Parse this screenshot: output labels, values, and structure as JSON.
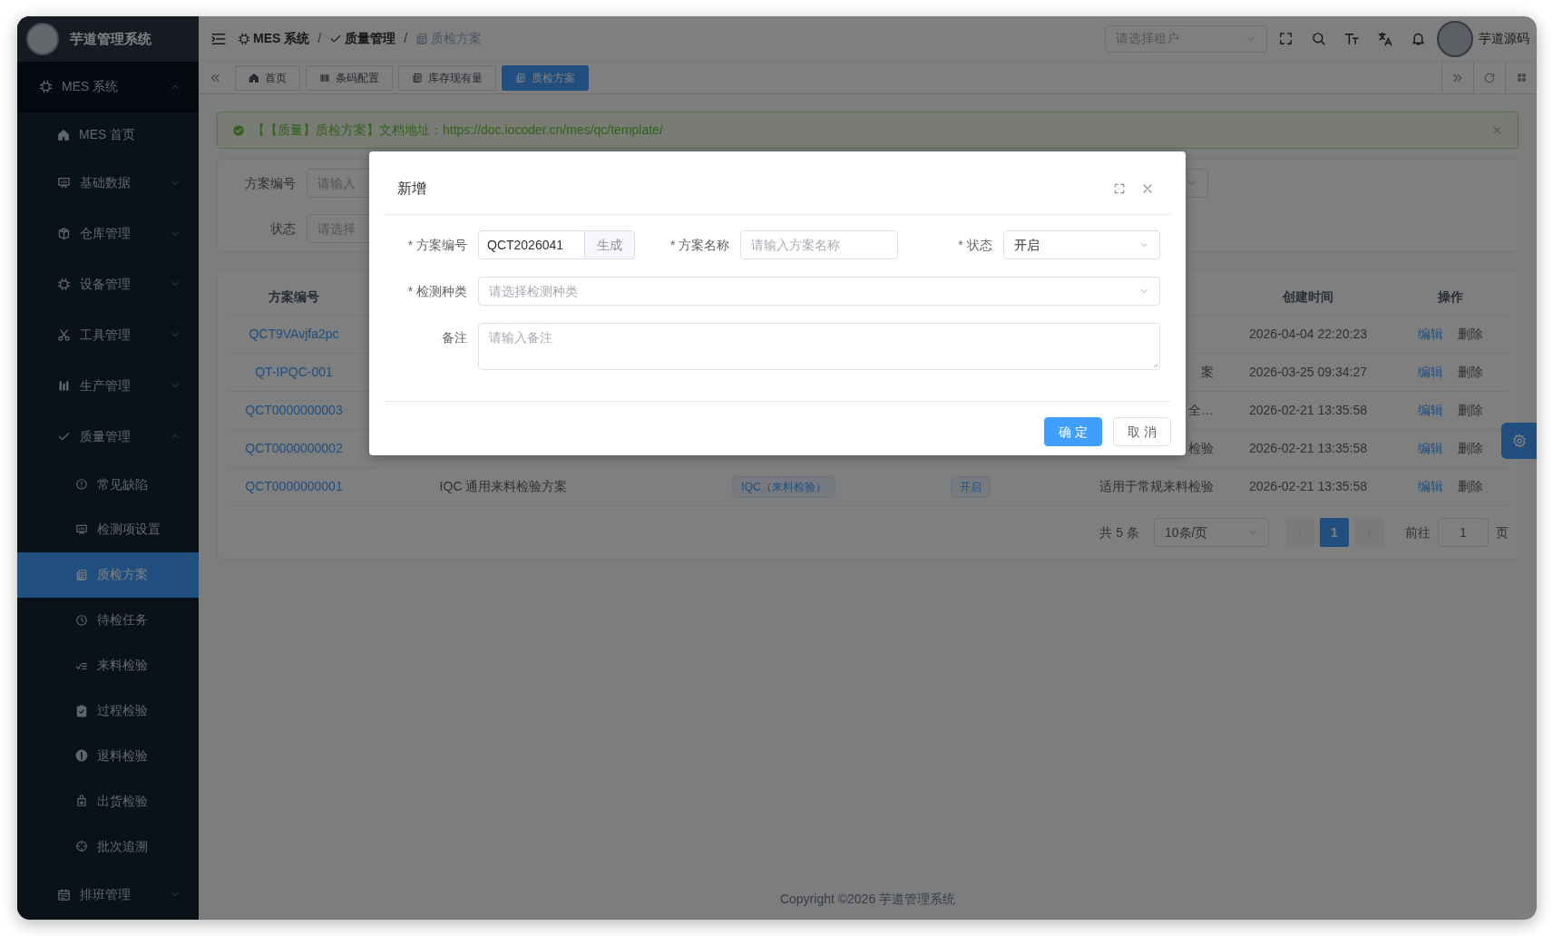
{
  "sidebar": {
    "title": "芋道管理系统",
    "menu": [
      {
        "label": "MES 系统",
        "expanded": true,
        "children": [
          {
            "label": "MES 首页",
            "selected": false
          },
          {
            "label": "基础数据",
            "expanded": false
          },
          {
            "label": "仓库管理",
            "expanded": false
          },
          {
            "label": "设备管理",
            "expanded": false
          },
          {
            "label": "工具管理",
            "expanded": false
          },
          {
            "label": "生产管理",
            "expanded": false
          },
          {
            "label": "质量管理",
            "expanded": true,
            "children": [
              {
                "label": "常见缺陷",
                "selected": false
              },
              {
                "label": "检测项设置",
                "selected": false
              },
              {
                "label": "质检方案",
                "selected": true
              },
              {
                "label": "待检任务",
                "selected": false
              },
              {
                "label": "来料检验",
                "selected": false
              },
              {
                "label": "过程检验",
                "selected": false
              },
              {
                "label": "退料检验",
                "selected": false
              },
              {
                "label": "出货检验",
                "selected": false
              },
              {
                "label": "批次追溯",
                "selected": false
              }
            ]
          },
          {
            "label": "排班管理",
            "expanded": false
          }
        ]
      }
    ]
  },
  "header": {
    "breadcrumb": {
      "separator": "/",
      "items": [
        {
          "label": "MES 系统",
          "current": false
        },
        {
          "label": "质量管理",
          "current": false
        },
        {
          "label": "质检方案",
          "current": true
        }
      ]
    },
    "tenant_select": {
      "placeholder": "请选择租户"
    },
    "user": "芋道源码"
  },
  "tabs": [
    {
      "label": "首页",
      "selected": false
    },
    {
      "label": "条码配置",
      "selected": false
    },
    {
      "label": "库存现有量",
      "selected": false
    },
    {
      "label": "质检方案",
      "selected": true
    }
  ],
  "alert": {
    "text": "【【质量】质检方案】文档地址：",
    "link": "https://doc.iocoder.cn/mes/qc/template/"
  },
  "search": {
    "fields": [
      {
        "label": "方案编号",
        "placeholder": "请输入"
      },
      {
        "label": "状态",
        "placeholder": "请选择"
      }
    ]
  },
  "table": {
    "columns": {
      "code": "方案编号",
      "created": "创建时间",
      "actions": "操作"
    },
    "rows": [
      {
        "code": "QCT9VAvjfa2pc",
        "created": "2026-04-04 22:20:23",
        "actions": [
          {
            "label": "编辑",
            "kind": "edit"
          },
          {
            "label": "删除",
            "kind": "delete"
          }
        ]
      },
      {
        "code": "QT-IPQC-001",
        "remark": "案",
        "created": "2026-03-25 09:34:27",
        "actions": [
          {
            "label": "编辑",
            "kind": "edit"
          },
          {
            "label": "删除",
            "kind": "delete"
          }
        ]
      },
      {
        "code": "QCT0000000003",
        "remark": "全…",
        "created": "2026-02-21 13:35:58",
        "actions": [
          {
            "label": "编辑",
            "kind": "edit"
          },
          {
            "label": "删除",
            "kind": "delete"
          }
        ]
      },
      {
        "code": "QCT0000000002",
        "remark": "检验",
        "created": "2026-02-21 13:35:58",
        "actions": [
          {
            "label": "编辑",
            "kind": "edit"
          },
          {
            "label": "删除",
            "kind": "delete"
          }
        ]
      },
      {
        "code": "QCT0000000001",
        "name": "IQC 通用来料检验方案",
        "type": "IQC（来料检验）",
        "status": "开启",
        "remark": "适用于常规来料检验",
        "created": "2026-02-21 13:35:58",
        "actions": [
          {
            "label": "编辑",
            "kind": "edit"
          },
          {
            "label": "删除",
            "kind": "delete"
          }
        ]
      }
    ]
  },
  "pagination": {
    "total": "共 5 条",
    "page_size": "10条/页",
    "pages": [
      {
        "label": "1",
        "selected": true
      }
    ],
    "goto_label": "前往",
    "goto_value": "1",
    "goto_suffix": "页"
  },
  "footer": "Copyright ©2026 芋道管理系统",
  "dialog": {
    "title": "新增",
    "rows": [
      [
        {
          "kind": "input-append",
          "label": "* 方案编号",
          "value": "QCT2026041",
          "append": "生成"
        },
        {
          "kind": "input",
          "label": "* 方案名称",
          "placeholder": "请输入方案名称"
        },
        {
          "kind": "select",
          "label": "* 状态",
          "value": "开启"
        }
      ],
      [
        {
          "kind": "select",
          "label": "* 检测种类",
          "placeholder": "请选择检测种类"
        }
      ],
      [
        {
          "kind": "textarea",
          "label": "备注",
          "placeholder": "请输入备注"
        }
      ]
    ],
    "buttons": [
      {
        "label": "确 定",
        "kind": "primary"
      },
      {
        "label": "取 消",
        "kind": "default"
      }
    ]
  }
}
